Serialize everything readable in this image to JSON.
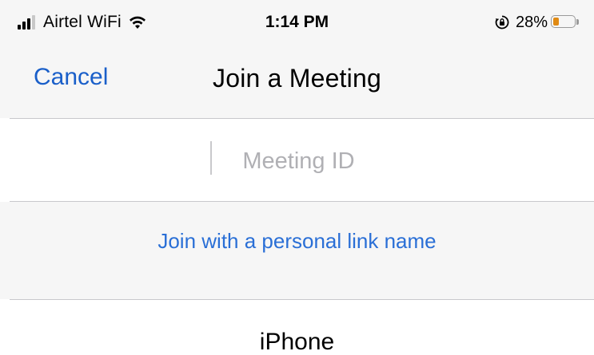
{
  "status_bar": {
    "carrier": "Airtel WiFi",
    "time": "1:14 PM",
    "battery_percent_label": "28%",
    "battery_level": 0.28,
    "battery_color": "#e08a14",
    "icons": {
      "signal": "signal-bars-icon",
      "wifi": "wifi-icon",
      "orientation_lock": "orientation-lock-icon",
      "battery": "battery-icon"
    }
  },
  "nav": {
    "cancel_label": "Cancel",
    "title": "Join a Meeting",
    "accent_color": "#1a5fc9"
  },
  "meeting_id": {
    "value": "",
    "placeholder": "Meeting ID"
  },
  "personal_link": {
    "label": "Join with a personal link name"
  },
  "device": {
    "name": "iPhone"
  }
}
